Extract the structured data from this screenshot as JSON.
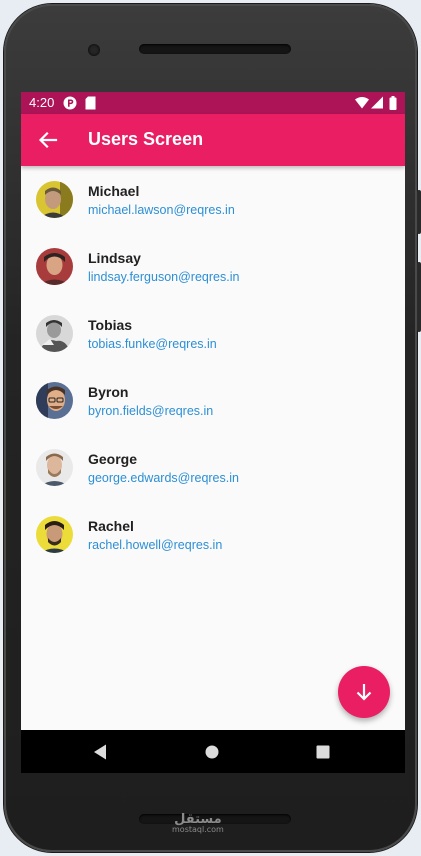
{
  "status_bar": {
    "time": "4:20",
    "icons": [
      "notification-p-icon",
      "sd-card-icon",
      "wifi-icon",
      "cell-signal-icon",
      "battery-icon"
    ]
  },
  "app_bar": {
    "title": "Users Screen",
    "back_icon": "arrow-back-icon"
  },
  "users": [
    {
      "name": "Michael",
      "email": "michael.lawson@reqres.in"
    },
    {
      "name": "Lindsay",
      "email": "lindsay.ferguson@reqres.in"
    },
    {
      "name": "Tobias",
      "email": "tobias.funke@reqres.in"
    },
    {
      "name": "Byron",
      "email": "byron.fields@reqres.in"
    },
    {
      "name": "George",
      "email": "george.edwards@reqres.in"
    },
    {
      "name": "Rachel",
      "email": "rachel.howell@reqres.in"
    }
  ],
  "fab": {
    "icon": "arrow-down-icon"
  },
  "nav_bar": {
    "buttons": [
      "back-triangle-icon",
      "home-circle-icon",
      "recents-square-icon"
    ]
  },
  "watermark": {
    "arabic": "مستقل",
    "latin": "mostaql.com"
  },
  "colors": {
    "primary": "#e91e63",
    "primary_dark": "#ad1457",
    "email_link": "#2d8fd5"
  }
}
